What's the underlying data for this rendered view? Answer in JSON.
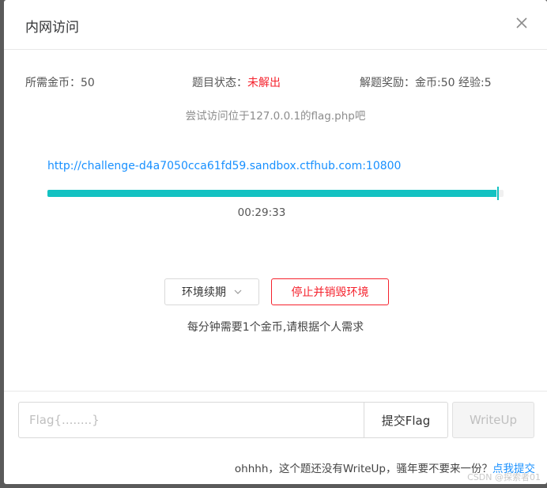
{
  "dialog": {
    "title": "内网访问"
  },
  "info": {
    "cost_label": "所需金币：",
    "cost_value": "50",
    "status_label": "题目状态：",
    "status_value": "未解出",
    "reward_label": "解题奖励：",
    "reward_value": "金币:50 经验:5"
  },
  "hint": "尝试访问位于127.0.0.1的flag.php吧",
  "environment": {
    "url": "http://challenge-d4a7050cca61fd59.sandbox.ctfhub.com:10800",
    "remaining_fraction": 0.985,
    "timer": "00:29:33"
  },
  "actions": {
    "renew_label": "环境续期",
    "stop_label": "停止并销毁环境",
    "cost_note": "每分钟需要1个金币,请根据个人需求"
  },
  "flag_form": {
    "placeholder": "Flag{........}",
    "value": "",
    "submit_label": "提交Flag",
    "writeup_label": "WriteUp"
  },
  "footer": {
    "note": "ohhhh，这个题还没有WriteUp，骚年要不要来一份？",
    "link": "点我提交"
  },
  "watermark": "CSDN @探索者01",
  "colors": {
    "accent": "#13c2c2",
    "danger": "#f5222d",
    "link": "#1890ff"
  }
}
